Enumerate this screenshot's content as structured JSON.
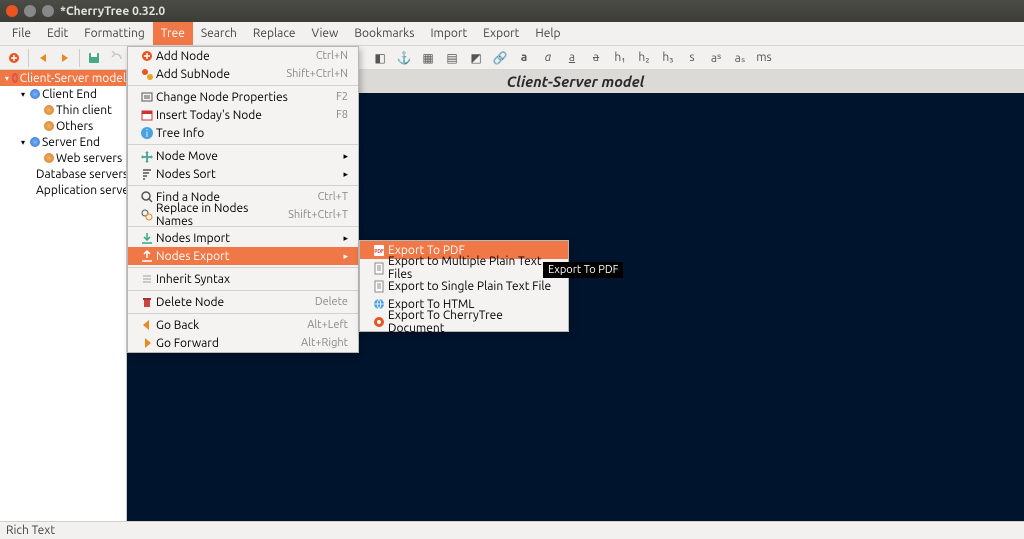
{
  "window": {
    "title": "*CherryTree 0.32.0"
  },
  "menubar": {
    "items": [
      "File",
      "Edit",
      "Formatting",
      "Tree",
      "Search",
      "Replace",
      "View",
      "Bookmarks",
      "Import",
      "Export",
      "Help"
    ],
    "open_index": 3
  },
  "tree_menu": {
    "items": [
      {
        "icon": "add-node",
        "label": "Add Node",
        "shortcut": "Ctrl+N"
      },
      {
        "icon": "add-subnode",
        "label": "Add SubNode",
        "shortcut": "Shift+Ctrl+N"
      },
      {
        "sep": true
      },
      {
        "icon": "properties",
        "label": "Change Node Properties",
        "shortcut": "F2"
      },
      {
        "icon": "calendar",
        "label": "Insert Today's Node",
        "shortcut": "F8"
      },
      {
        "icon": "info",
        "label": "Tree Info"
      },
      {
        "sep": true
      },
      {
        "icon": "move",
        "label": "Node Move",
        "submenu": true
      },
      {
        "icon": "sort",
        "label": "Nodes Sort",
        "submenu": true
      },
      {
        "sep": true
      },
      {
        "icon": "find",
        "label": "Find a Node",
        "shortcut": "Ctrl+T"
      },
      {
        "icon": "replace",
        "label": "Replace in Nodes Names",
        "shortcut": "Shift+Ctrl+T"
      },
      {
        "sep": true
      },
      {
        "icon": "import",
        "label": "Nodes Import",
        "submenu": true
      },
      {
        "icon": "export",
        "label": "Nodes Export",
        "submenu": true,
        "highlight": true
      },
      {
        "sep": true
      },
      {
        "icon": "inherit",
        "label": "Inherit Syntax"
      },
      {
        "sep": true
      },
      {
        "icon": "delete",
        "label": "Delete Node",
        "shortcut": "Delete"
      },
      {
        "sep": true
      },
      {
        "icon": "back",
        "label": "Go Back",
        "shortcut": "Alt+Left"
      },
      {
        "icon": "forward",
        "label": "Go Forward",
        "shortcut": "Alt+Right"
      }
    ]
  },
  "export_submenu": {
    "items": [
      {
        "icon": "pdf",
        "label": "Export To PDF",
        "highlight": true
      },
      {
        "icon": "txt",
        "label": "Export to Multiple Plain Text Files"
      },
      {
        "icon": "txt",
        "label": "Export to Single Plain Text File"
      },
      {
        "icon": "html",
        "label": "Export To HTML"
      },
      {
        "icon": "ct",
        "label": "Export To CherryTree Document"
      }
    ]
  },
  "tooltip": {
    "text": "Export To PDF"
  },
  "sidebar": {
    "nodes": [
      {
        "depth": 0,
        "exp": true,
        "dot": "red",
        "label": "Client-Server model",
        "sel": true
      },
      {
        "depth": 1,
        "exp": true,
        "dot": "blue",
        "label": "Client End"
      },
      {
        "depth": 2,
        "dot": "orn",
        "label": "Thin client"
      },
      {
        "depth": 2,
        "dot": "orn",
        "label": "Others"
      },
      {
        "depth": 1,
        "exp": true,
        "dot": "blue",
        "label": "Server End"
      },
      {
        "depth": 2,
        "dot": "orn",
        "label": "Web servers"
      },
      {
        "depth": 2,
        "dot": "orn",
        "label": "Database servers"
      },
      {
        "depth": 2,
        "dot": "orn",
        "label": "Application servers"
      }
    ]
  },
  "editor": {
    "title": "Client-Server model"
  },
  "toolbar2": {
    "items": [
      "picker",
      "anchor",
      "image-ins",
      "table",
      "code",
      "link",
      "bold",
      "italic",
      "underline",
      "strike",
      "h1",
      "h2",
      "h3",
      "small",
      "sup",
      "sub",
      "mono"
    ],
    "glyphs": [
      "◧",
      "⚓",
      "▦",
      "▤",
      "◩",
      "🔗",
      "a",
      "a",
      "a",
      "a",
      "h₁",
      "h₂",
      "h₃",
      "s",
      "aˢ",
      "aₛ",
      "ms"
    ]
  },
  "statusbar": {
    "text": "Rich Text"
  }
}
